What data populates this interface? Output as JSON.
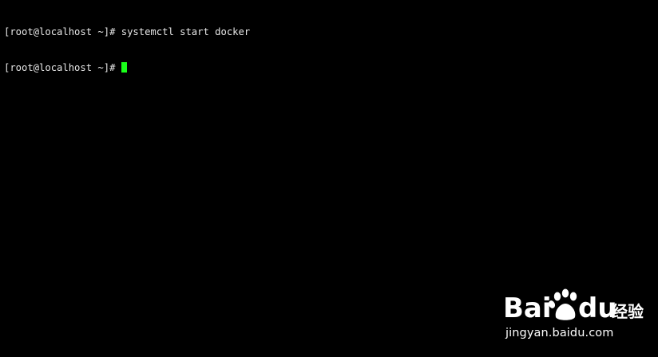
{
  "terminal": {
    "lines": [
      {
        "prompt": "[root@localhost ~]# ",
        "command": "systemctl start docker"
      },
      {
        "prompt": "[root@localhost ~]# ",
        "command": ""
      }
    ],
    "cursor_color": "#19ff19",
    "text_color": "#e6e6e6",
    "background_color": "#000000"
  },
  "watermark": {
    "brand_text_ba": "Bai",
    "brand_text_du": "du",
    "brand_text_cn": "经验",
    "url": "jingyan.baidu.com"
  }
}
